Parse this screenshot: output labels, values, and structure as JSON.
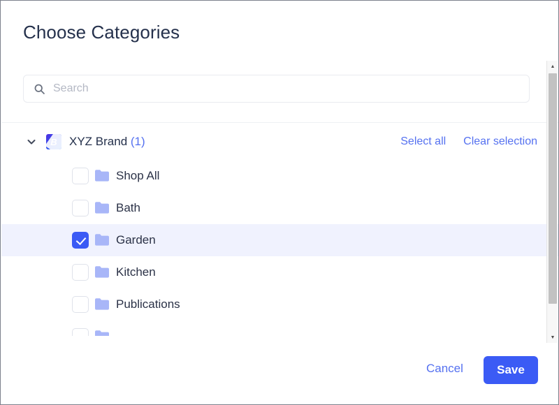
{
  "dialog": {
    "title": "Choose Categories"
  },
  "search": {
    "placeholder": "Search",
    "value": "",
    "icon": "search-icon"
  },
  "brand": {
    "name": "XYZ Brand",
    "count": "(1)",
    "badge_letter": "B",
    "expanded": true,
    "chevron_icon": "chevron-down-icon",
    "select_all_label": "Select all",
    "clear_selection_label": "Clear selection"
  },
  "categories": [
    {
      "label": "Shop All",
      "checked": false,
      "icon": "folder-icon"
    },
    {
      "label": "Bath",
      "checked": false,
      "icon": "folder-icon"
    },
    {
      "label": "Garden",
      "checked": true,
      "icon": "folder-icon"
    },
    {
      "label": "Kitchen",
      "checked": false,
      "icon": "folder-icon"
    },
    {
      "label": "Publications",
      "checked": false,
      "icon": "folder-icon"
    },
    {
      "label": "",
      "checked": false,
      "icon": "folder-icon"
    }
  ],
  "footer": {
    "cancel_label": "Cancel",
    "save_label": "Save"
  },
  "colors": {
    "accent": "#3b5bf5",
    "link": "#5571f0",
    "selected_row": "#f0f2fe",
    "folder": "#a8b6f8",
    "title_text": "#25314c",
    "placeholder": "#b4b8c4"
  }
}
